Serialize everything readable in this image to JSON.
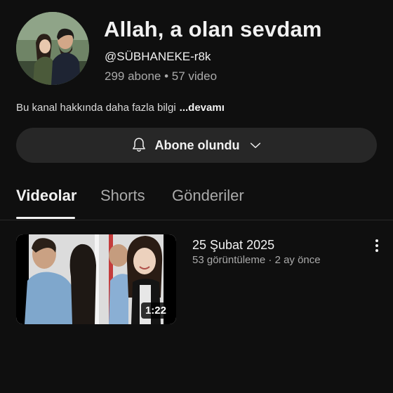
{
  "channel": {
    "name": "Allah, a olan sevdam",
    "handle": "@SÜBHANEKE-r8k",
    "stats": "299 abone • 57 video",
    "about_text": "Bu kanal hakkında daha fazla bilgi",
    "about_more": "...devamı"
  },
  "subscribe": {
    "label": "Abone olundu",
    "icon": "bell-icon",
    "dropdown_icon": "chevron-down-icon"
  },
  "tabs": [
    {
      "label": "Videolar",
      "active": true
    },
    {
      "label": "Shorts",
      "active": false
    },
    {
      "label": "Gönderiler",
      "active": false
    }
  ],
  "videos": [
    {
      "title": "25 Şubat 2025",
      "views": "53 görüntüleme",
      "age": "2 ay önce",
      "meta": "53 görüntüleme · 2 ay önce",
      "duration": "1:22"
    }
  ],
  "colors": {
    "background": "#0f0f0f",
    "button_bg": "#272727",
    "primary_text": "#f1f1f1",
    "secondary_text": "#aaaaaa"
  }
}
